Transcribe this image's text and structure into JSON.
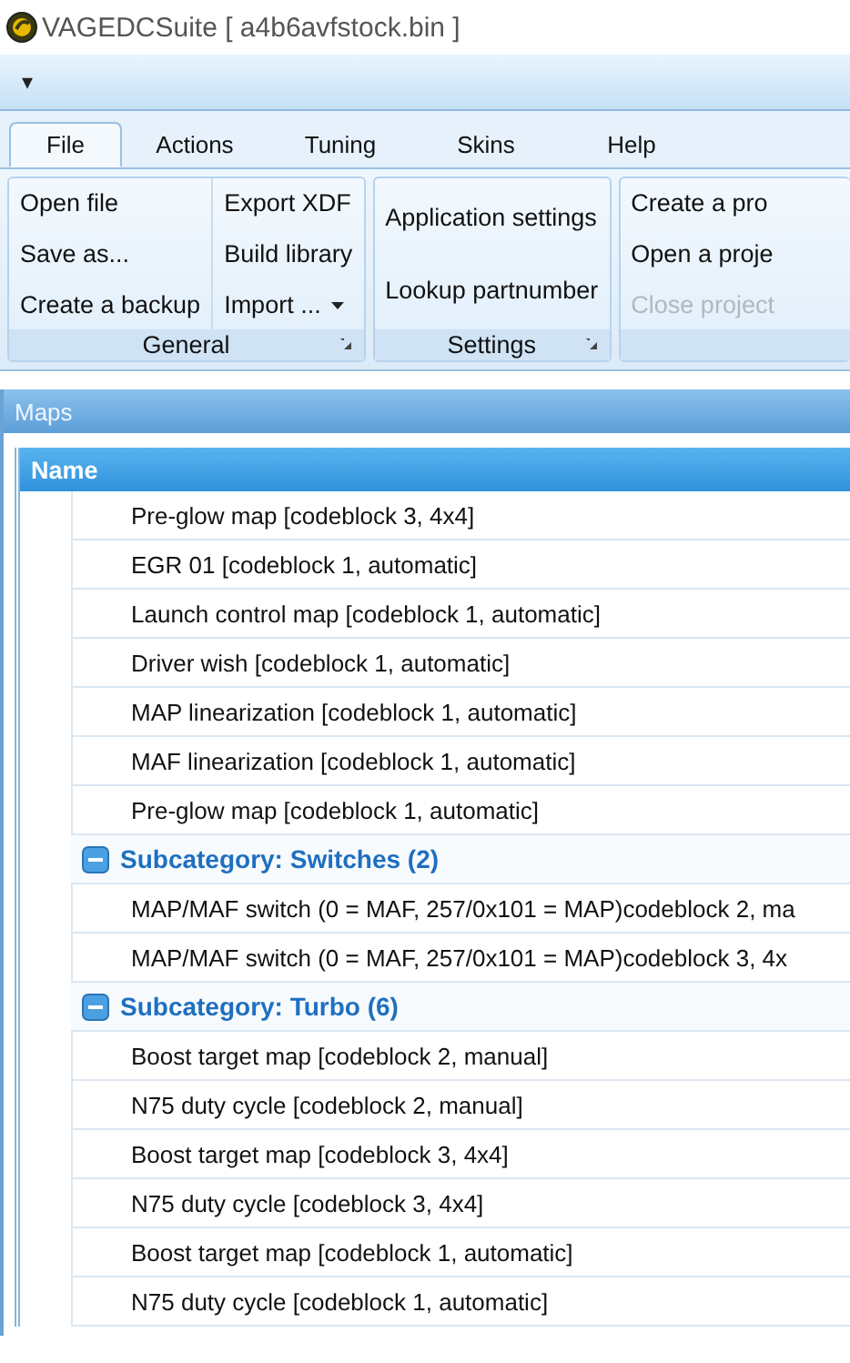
{
  "window": {
    "title": "VAGEDCSuite [ a4b6avfstock.bin ]"
  },
  "quick_access": {
    "menu": "▾"
  },
  "tabs": [
    {
      "label": "File",
      "selected": true
    },
    {
      "label": "Actions",
      "selected": false
    },
    {
      "label": "Tuning",
      "selected": false
    },
    {
      "label": "Skins",
      "selected": false
    },
    {
      "label": "Help",
      "selected": false
    }
  ],
  "ribbon_groups": [
    {
      "label": "General",
      "launcher": true,
      "columns": [
        [
          {
            "label": "Open file",
            "disabled": false
          },
          {
            "label": "Save as...",
            "disabled": false
          },
          {
            "label": "Create a backup",
            "disabled": false
          }
        ],
        [
          {
            "label": "Export XDF",
            "disabled": false
          },
          {
            "label": "Build library",
            "disabled": false
          },
          {
            "label": "Import ...",
            "disabled": false,
            "dropdown": true
          }
        ]
      ]
    },
    {
      "label": "Settings",
      "launcher": true,
      "columns": [
        [
          {
            "label": "Application settings",
            "disabled": false
          },
          {
            "label": "Lookup partnumber",
            "disabled": false
          }
        ]
      ]
    },
    {
      "launcher": false,
      "columns": [
        [
          {
            "label": "Create a pro",
            "disabled": false
          },
          {
            "label": "Open a proje",
            "disabled": false
          },
          {
            "label": "Close project",
            "disabled": true
          }
        ]
      ]
    }
  ],
  "maps_panel": {
    "title": "Maps",
    "columns": [
      "Name"
    ],
    "rows": [
      {
        "label": "Pre-glow map [codeblock 3, 4x4]"
      },
      {
        "label": "EGR 01 [codeblock 1, automatic]"
      },
      {
        "label": "Launch control map [codeblock 1, automatic]"
      },
      {
        "label": "Driver wish [codeblock 1, automatic]"
      },
      {
        "label": "MAP linearization [codeblock 1, automatic]"
      },
      {
        "label": "MAF linearization [codeblock 1, automatic]"
      },
      {
        "label": "Pre-glow map [codeblock 1, automatic]"
      }
    ],
    "groups": [
      {
        "title": "Subcategory: Switches (2)",
        "expanded": true,
        "children": [
          {
            "label": "MAP/MAF switch (0 = MAF, 257/0x101 = MAP)codeblock 2, ma"
          },
          {
            "label": "MAP/MAF switch (0 = MAF, 257/0x101 = MAP)codeblock 3, 4x"
          }
        ]
      },
      {
        "title": "Subcategory: Turbo (6)",
        "expanded": true,
        "children": [
          {
            "label": "Boost target map [codeblock 2, manual]"
          },
          {
            "label": "N75 duty cycle [codeblock 2, manual]"
          },
          {
            "label": "Boost target map [codeblock 3, 4x4]"
          },
          {
            "label": "N75 duty cycle [codeblock 3, 4x4]"
          },
          {
            "label": "Boost target map [codeblock 1, automatic]"
          },
          {
            "label": "N75 duty cycle [codeblock 1, automatic]"
          }
        ]
      }
    ]
  }
}
